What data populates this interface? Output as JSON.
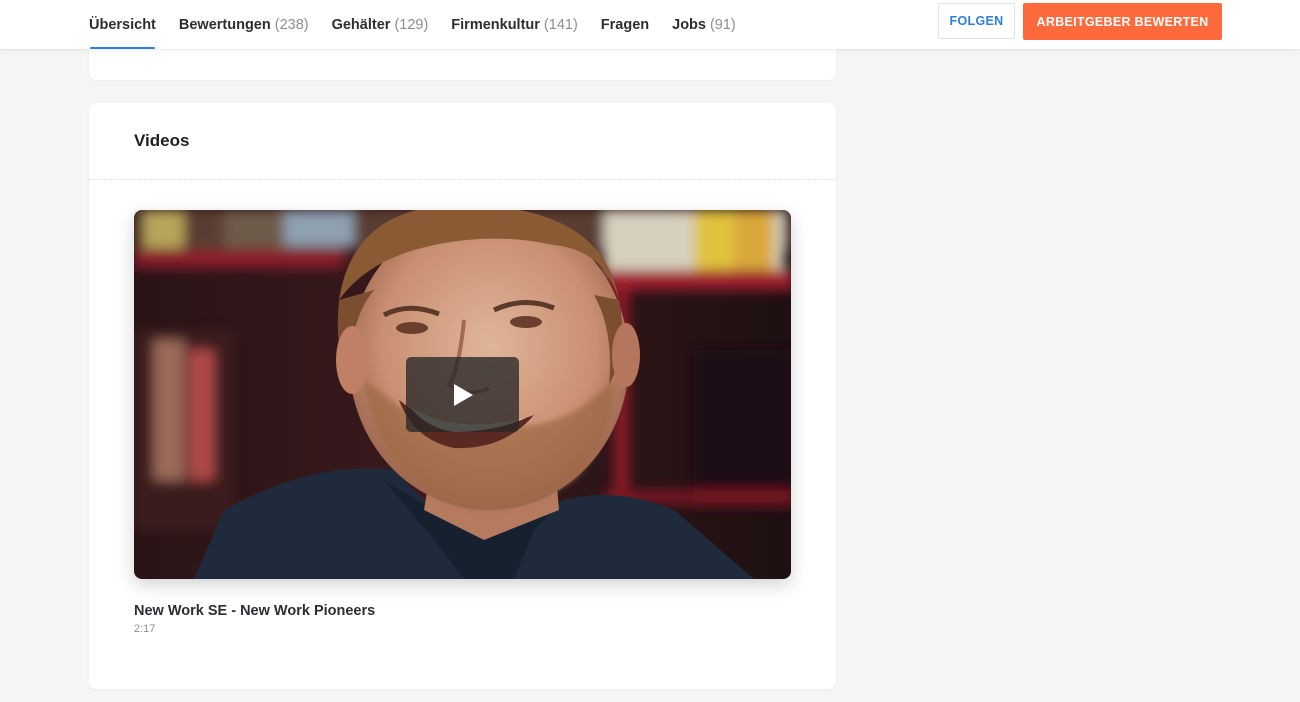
{
  "nav": {
    "tabs": [
      {
        "label": "Übersicht",
        "count": ""
      },
      {
        "label": "Bewertungen",
        "count": "(238)"
      },
      {
        "label": "Gehälter",
        "count": "(129)"
      },
      {
        "label": "Firmenkultur",
        "count": "(141)"
      },
      {
        "label": "Fragen",
        "count": ""
      },
      {
        "label": "Jobs",
        "count": "(91)"
      }
    ],
    "follow_label": "FOLGEN",
    "rate_label": "ARBEITGEBER BEWERTEN"
  },
  "videos": {
    "section_title": "Videos",
    "items": [
      {
        "title": "New Work SE - New Work Pioneers",
        "duration": "2:17"
      }
    ]
  },
  "colors": {
    "accent_blue": "#2e7ee0",
    "cta_orange": "#ff6a3d",
    "page_bg": "#f4f5f4"
  },
  "icons": {
    "play": "play-icon"
  }
}
